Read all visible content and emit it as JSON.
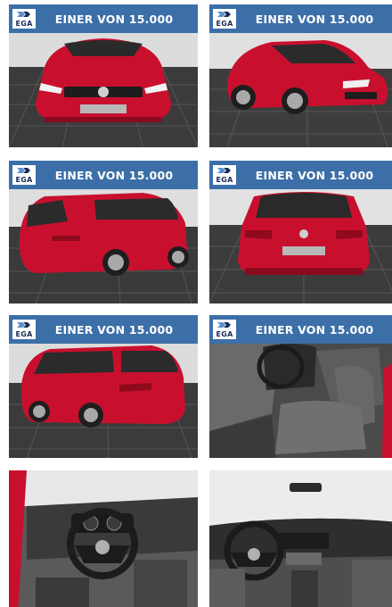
{
  "gallery": {
    "tiles": [
      {
        "banner": "EINER VON 15.000",
        "logo": "EGA",
        "photo": "car-front-view"
      },
      {
        "banner": "EINER VON 15.000",
        "logo": "EGA",
        "photo": "car-front-three-quarter-view"
      },
      {
        "banner": "EINER VON 15.000",
        "logo": "EGA",
        "photo": "car-rear-three-quarter-view"
      },
      {
        "banner": "EINER VON 15.000",
        "logo": "EGA",
        "photo": "car-rear-view"
      },
      {
        "banner": "EINER VON 15.000",
        "logo": "EGA",
        "photo": "car-side-rear-view"
      },
      {
        "banner": "EINER VON 15.000",
        "logo": "EGA",
        "photo": "car-interior-seats"
      },
      {
        "banner": "",
        "logo": "",
        "photo": "car-interior-steering-wheel"
      },
      {
        "banner": "",
        "logo": "",
        "photo": "car-interior-dashboard"
      }
    ]
  },
  "colors": {
    "banner": "#3c6fa8",
    "car_red": "#c8102e",
    "floor": "#3a3a3a"
  }
}
